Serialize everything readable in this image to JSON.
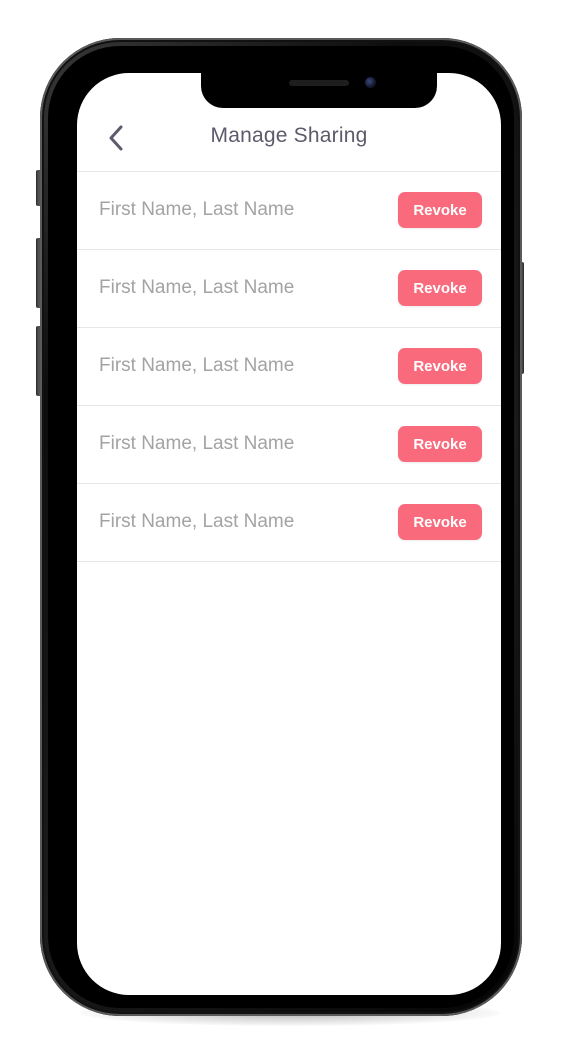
{
  "header": {
    "title": "Manage Sharing",
    "back_icon": "chevron-left-icon"
  },
  "shares": [
    {
      "name": "First Name, Last Name",
      "action_label": "Revoke"
    },
    {
      "name": "First Name, Last Name",
      "action_label": "Revoke"
    },
    {
      "name": "First Name, Last Name",
      "action_label": "Revoke"
    },
    {
      "name": "First Name, Last Name",
      "action_label": "Revoke"
    },
    {
      "name": "First Name, Last Name",
      "action_label": "Revoke"
    }
  ],
  "colors": {
    "accent": "#f86a7c",
    "title_text": "#5d5a6b",
    "name_text": "#a3a3a3",
    "divider": "#e6e6e6"
  }
}
